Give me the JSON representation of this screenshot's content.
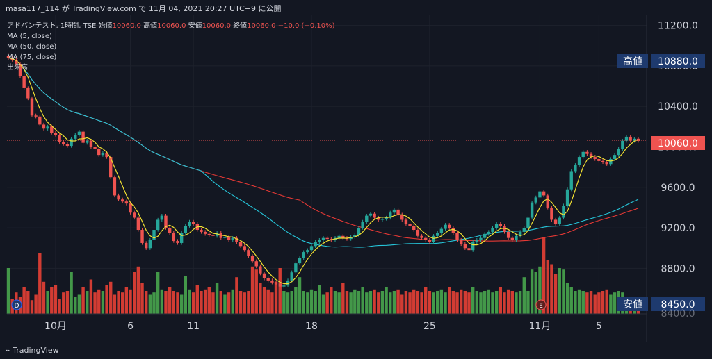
{
  "header": {
    "attribution": "masa117_114 が TradingView.com で 11月 04, 2021 20:27 UTC+9 に公開"
  },
  "legend": {
    "symbol": "アドバンテスト, 1時間, TSE",
    "open_label": "始値",
    "open": "10060.0",
    "high_label": "高値",
    "high": "10060.0",
    "low_label": "安値",
    "low": "10060.0",
    "close_label": "終値",
    "close": "10060.0",
    "change": "−10.0 (−0.10%)",
    "ma5": "MA (5, close)",
    "ma50": "MA (50, close)",
    "ma75": "MA (75, close)",
    "volume": "出来高"
  },
  "axis": {
    "y_ticks": [
      "11200.0",
      "10800.0",
      "10400.0",
      "10000.0",
      "9600.0",
      "9200.0",
      "8800.0"
    ],
    "y_tick_values": [
      11200,
      10800,
      10400,
      10000,
      9600,
      9200,
      8800
    ],
    "x_ticks": [
      "10月",
      "6",
      "11",
      "18",
      "25",
      "11月",
      "5"
    ],
    "x_tick_index": [
      12,
      31,
      47,
      77,
      107,
      135,
      150
    ]
  },
  "tags": {
    "high_label": "高値",
    "high_value": "10880.0",
    "last_value": "10060.0",
    "low_label": "安値",
    "low_value": "8450.0",
    "partial_value": "8400.0"
  },
  "markers": {
    "dividend": "D",
    "earnings": "E"
  },
  "footer": {
    "logo_text": "TradingView"
  },
  "colors": {
    "background": "#131722",
    "up": "#26a69a",
    "down": "#ef5350",
    "ma5": "#f2e132",
    "ma50": "#26c6da",
    "ma75": "#e53935",
    "tag_bg": "#1e3a6e",
    "last_bg": "#ef5350",
    "vol_up": "#4caf50",
    "vol_down": "#f44336"
  },
  "chart_data": {
    "type": "candlestick",
    "y_range": [
      8350,
      11300
    ],
    "close": [
      10880,
      10860,
      10820,
      10700,
      10580,
      10480,
      10310,
      10300,
      10220,
      10180,
      10200,
      10140,
      10120,
      10050,
      10030,
      10010,
      10080,
      10120,
      10150,
      10040,
      10060,
      10000,
      9980,
      9920,
      9940,
      9900,
      9700,
      9520,
      9480,
      9460,
      9440,
      9350,
      9300,
      9180,
      9050,
      9000,
      9080,
      9180,
      9280,
      9320,
      9200,
      9150,
      9070,
      9050,
      9150,
      9220,
      9260,
      9240,
      9180,
      9160,
      9140,
      9130,
      9120,
      9150,
      9100,
      9110,
      9080,
      9100,
      9060,
      9020,
      8980,
      8920,
      8870,
      8820,
      8750,
      8700,
      8680,
      8660,
      8650,
      8620,
      8630,
      8680,
      8760,
      8850,
      8900,
      8960,
      8980,
      9020,
      9060,
      9080,
      9100,
      9090,
      9080,
      9100,
      9120,
      9100,
      9090,
      9110,
      9130,
      9200,
      9260,
      9320,
      9340,
      9300,
      9280,
      9290,
      9300,
      9350,
      9380,
      9330,
      9280,
      9240,
      9220,
      9180,
      9120,
      9100,
      9080,
      9060,
      9120,
      9150,
      9190,
      9230,
      9200,
      9150,
      9080,
      9040,
      9000,
      8980,
      9060,
      9080,
      9100,
      9140,
      9160,
      9200,
      9240,
      9220,
      9160,
      9100,
      9080,
      9120,
      9160,
      9200,
      9300,
      9450,
      9500,
      9560,
      9520,
      9400,
      9280,
      9240,
      9300,
      9420,
      9580,
      9760,
      9820,
      9900,
      9950,
      9930,
      9900,
      9880,
      9860,
      9850,
      9830,
      9880,
      9920,
      9980,
      10060,
      10100,
      10060,
      10080,
      10060
    ],
    "volume": [
      0.6,
      0.2,
      0.28,
      0.22,
      0.35,
      0.3,
      0.18,
      0.25,
      0.8,
      0.42,
      0.3,
      0.35,
      0.38,
      0.2,
      0.28,
      0.3,
      0.55,
      0.22,
      0.25,
      0.35,
      0.3,
      0.45,
      0.28,
      0.32,
      0.3,
      0.38,
      0.42,
      0.25,
      0.3,
      0.28,
      0.35,
      0.32,
      0.55,
      0.62,
      0.4,
      0.3,
      0.25,
      0.28,
      0.55,
      0.32,
      0.3,
      0.35,
      0.3,
      0.28,
      0.25,
      0.5,
      0.32,
      0.28,
      0.38,
      0.3,
      0.32,
      0.35,
      0.28,
      0.4,
      0.3,
      0.25,
      0.28,
      0.32,
      0.48,
      0.3,
      0.28,
      0.3,
      0.62,
      0.58,
      0.4,
      0.35,
      0.32,
      0.28,
      0.42,
      0.6,
      0.3,
      0.28,
      0.3,
      0.35,
      0.48,
      0.3,
      0.28,
      0.32,
      0.3,
      0.38,
      0.25,
      0.28,
      0.35,
      0.3,
      0.28,
      0.4,
      0.3,
      0.28,
      0.32,
      0.3,
      0.35,
      0.28,
      0.3,
      0.32,
      0.28,
      0.3,
      0.35,
      0.28,
      0.3,
      0.32,
      0.25,
      0.3,
      0.28,
      0.32,
      0.3,
      0.28,
      0.35,
      0.3,
      0.28,
      0.3,
      0.32,
      0.28,
      0.35,
      0.3,
      0.28,
      0.32,
      0.3,
      0.28,
      0.35,
      0.3,
      0.28,
      0.3,
      0.32,
      0.28,
      0.3,
      0.35,
      0.28,
      0.32,
      0.3,
      0.28,
      0.3,
      0.48,
      0.3,
      0.58,
      0.55,
      0.62,
      1.0,
      0.7,
      0.65,
      0.52,
      0.6,
      0.58,
      0.4,
      0.35,
      0.3,
      0.32,
      0.3,
      0.28,
      0.3,
      0.25,
      0.28,
      0.3,
      0.32,
      0.25,
      0.28,
      0.3,
      0.28,
      0.22,
      0.2,
      0.18,
      0.16
    ]
  }
}
